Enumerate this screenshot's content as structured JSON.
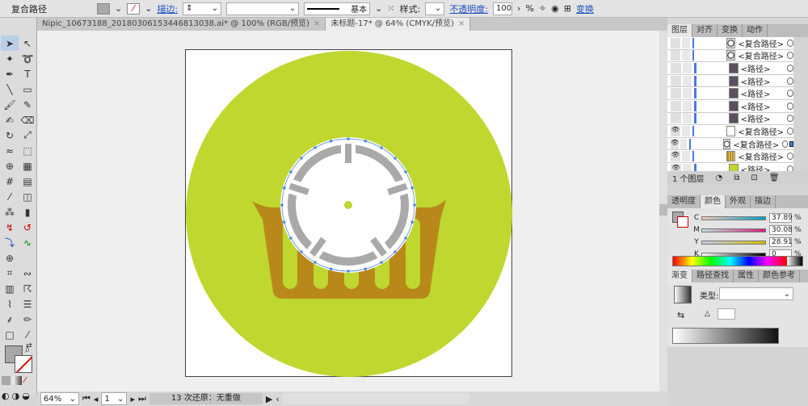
{
  "control_bar": {
    "selection_type": "复合路径",
    "stroke_label": "描边:",
    "stroke_profile": "基本",
    "style_label": "样式:",
    "opacity_label": "不透明度:",
    "opacity_value": "100",
    "percent": "%",
    "transform_link": "变换"
  },
  "doc_tabs": [
    {
      "label": "Nipic_10673188_20180306153446813038.ai* @ 100% (RGB/预览)",
      "active": false
    },
    {
      "label": "未标题-17* @ 64% (CMYK/预览)",
      "active": true
    }
  ],
  "toolbox": {
    "tools": [
      "selection-icon",
      "direct-selection-icon",
      "magic-wand-icon",
      "lasso-icon",
      "pen-icon",
      "type-icon",
      "line-icon",
      "rectangle-icon",
      "paintbrush-icon",
      "pencil-icon",
      "blob-brush-icon",
      "eraser-icon",
      "rotate-icon",
      "scale-icon",
      "warp-icon",
      "free-transform-icon",
      "shape-builder-icon",
      "perspective-grid-icon",
      "mesh-icon",
      "gradient-icon",
      "eyedropper-icon",
      "blend-icon",
      "symbol-sprayer-icon",
      "column-graph-icon",
      "custom-tool-1-icon",
      "custom-tool-2-icon",
      "custom-tool-3-icon",
      "custom-tool-4-icon",
      "crosshair-icon",
      "",
      "envelope-icon",
      "wave-icon",
      "grid-icon",
      "hand-draw-icon",
      "path-icon",
      "align-icon",
      "dropper-2-icon",
      "pen-2-icon",
      "artboard-icon",
      "slice-icon",
      "eraser-2-icon",
      "zoom-icon"
    ]
  },
  "artwork": {
    "background": "#bfd72f",
    "basket": "#b8891a",
    "wheel_rim": "#a9a9a9",
    "wheel_spokes": "#ffffff",
    "selection": "#3f7be8"
  },
  "layers_panel": {
    "tabs": [
      "图层",
      "对齐",
      "变换",
      "动作"
    ],
    "rows": [
      {
        "name": "<复合路径>",
        "visible": false,
        "thumb": "ring"
      },
      {
        "name": "<复合路径>",
        "visible": false,
        "thumb": "ring"
      },
      {
        "name": "<路径>",
        "visible": false,
        "thumb": "dark"
      },
      {
        "name": "<路径>",
        "visible": false,
        "thumb": "dark"
      },
      {
        "name": "<路径>",
        "visible": false,
        "thumb": "dark"
      },
      {
        "name": "<路径>",
        "visible": false,
        "thumb": "dark"
      },
      {
        "name": "<路径>",
        "visible": false,
        "thumb": "dark"
      },
      {
        "name": "<复合路径>",
        "visible": true,
        "thumb": "white"
      },
      {
        "name": "<复合路径>",
        "visible": true,
        "thumb": "ring",
        "selected": true
      },
      {
        "name": "<复合路径>",
        "visible": true,
        "thumb": "basket"
      },
      {
        "name": "<路径>",
        "visible": true,
        "thumb": "green"
      }
    ],
    "footer": "1 个图层"
  },
  "color_panel": {
    "tabs": [
      "透明度",
      "颜色",
      "外观",
      "描边"
    ],
    "channels": [
      {
        "label": "C",
        "value": "37.89"
      },
      {
        "label": "M",
        "value": "30.08"
      },
      {
        "label": "Y",
        "value": "28.91"
      },
      {
        "label": "K",
        "value": "0"
      }
    ],
    "percent": "%"
  },
  "gradient_panel": {
    "tabs": [
      "渐变",
      "路径查找",
      "属性",
      "颜色参考"
    ],
    "type_label": "类型:"
  },
  "status_bar": {
    "zoom": "64%",
    "page": "1",
    "history": "13 次还原：无重做"
  }
}
